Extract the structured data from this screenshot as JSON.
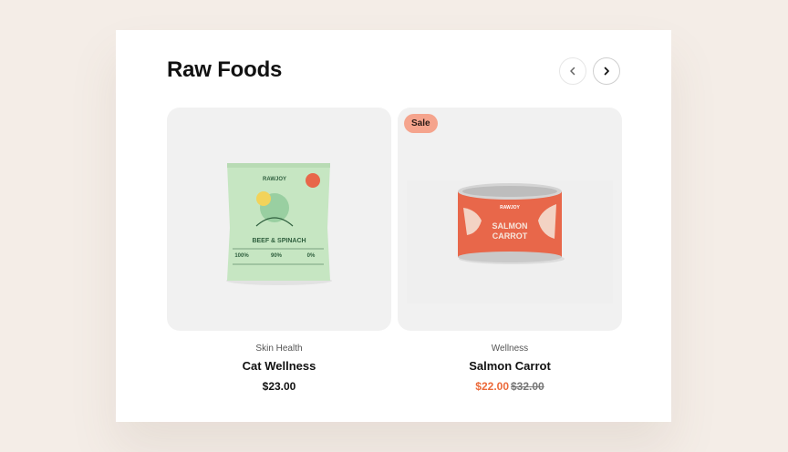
{
  "section": {
    "title": "Raw Foods"
  },
  "products": [
    {
      "category": "Skin Health",
      "name": "Cat Wellness",
      "price": "$23.00",
      "package": {
        "brand": "RAWJOY",
        "label": "BEEF & SPINACH",
        "stats": [
          "100%",
          "90%",
          "0%"
        ]
      }
    },
    {
      "badge": "Sale",
      "category": "Wellness",
      "name": "Salmon Carrot",
      "sale_price": "$22.00",
      "old_price": "$32.00",
      "package": {
        "brand": "RAWJOY",
        "label_line1": "SALMON",
        "label_line2": "CARROT"
      }
    }
  ],
  "colors": {
    "accent": "#ec6a3a",
    "badge": "#f5a48d",
    "bag": "#c6e6c2",
    "can": "#e8674a"
  },
  "icons": {
    "prev": "chevron-left-icon",
    "next": "chevron-right-icon"
  }
}
